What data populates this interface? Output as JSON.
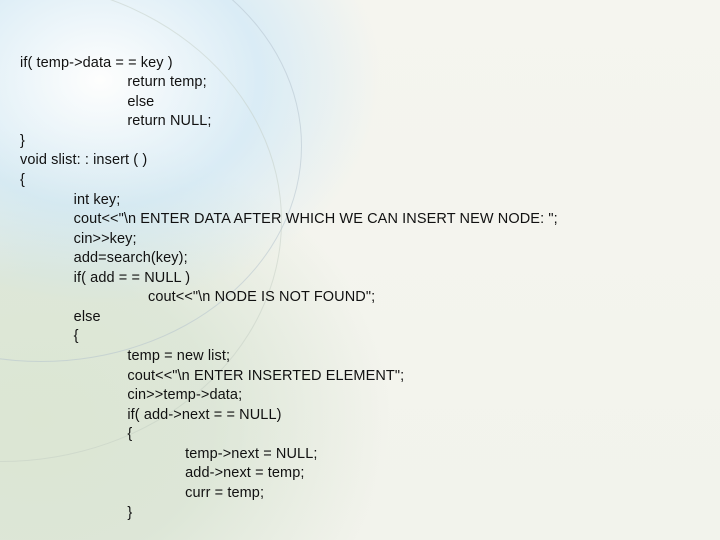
{
  "code": {
    "lines": [
      "if( temp->data = = key )",
      "                          return temp;",
      "                          else",
      "                          return NULL;",
      "}",
      "void slist: : insert ( )",
      "{",
      "             int key;",
      "             cout<<\"\\n ENTER DATA AFTER WHICH WE CAN INSERT NEW NODE: \";",
      "             cin>>key;",
      "             add=search(key);",
      "             if( add = = NULL )",
      "                               cout<<\"\\n NODE IS NOT FOUND\";",
      "             else",
      "             {",
      "                          temp = new list;",
      "                          cout<<\"\\n ENTER INSERTED ELEMENT\";",
      "                          cin>>temp->data;",
      "                          if( add->next = = NULL)",
      "                          {",
      "                                        temp->next = NULL;",
      "                                        add->next = temp;",
      "                                        curr = temp;",
      "                          }"
    ]
  }
}
